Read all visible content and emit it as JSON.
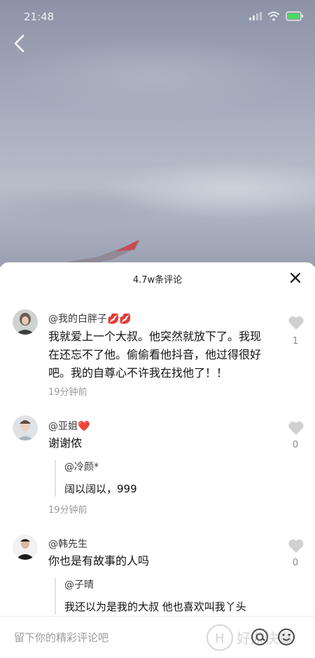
{
  "status_bar": {
    "time": "21:48"
  },
  "sheet": {
    "title": "4.7w条评论"
  },
  "comments": [
    {
      "user": "@我的白胖子💋💋",
      "text": "我就爱上一个大叔。他突然就放下了。我现在还忘不了他。偷偷看他抖音，他过得很好吧。我的自尊心不许我在找他了！！",
      "time": "19分钟前",
      "likes": "1"
    },
    {
      "user": "@亚姐❤️",
      "text": "谢谢侬",
      "reply_user": "@冷颜*",
      "reply_text": "阔以阔以，999",
      "time": "19分钟前",
      "likes": "0"
    },
    {
      "user": "@韩先生",
      "text": "你也是有故事的人吗",
      "reply_user": "@子晴",
      "reply_text": "我还以为是我的大叔 他也喜欢叫我丫头",
      "likes": "0"
    }
  ],
  "input": {
    "placeholder": "留下你的精彩评论吧"
  },
  "watermark": {
    "text": "好游快爆"
  },
  "icons": [
    "back-icon",
    "close-icon",
    "heart-icon",
    "at-icon",
    "emoji-icon",
    "wifi-icon",
    "signal-icon",
    "battery-icon"
  ],
  "colors": {
    "accent_heart": "#d0d0d0",
    "battery": "#4cd964"
  }
}
